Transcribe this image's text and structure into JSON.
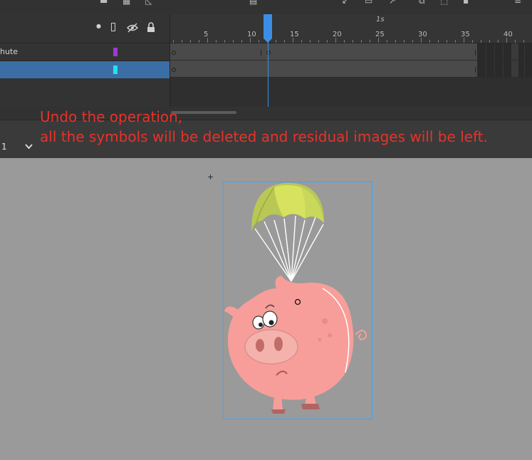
{
  "timeline": {
    "ruler_labels": [
      "5",
      "10",
      "15",
      "20",
      "25",
      "30",
      "35",
      "40"
    ],
    "time_marker": "1s",
    "current_frame": 12
  },
  "layers": [
    {
      "name": "hute",
      "color": "#9b3bd1",
      "selected": false
    },
    {
      "name": "",
      "color": "#26e0f0",
      "selected": true
    }
  ],
  "scene": {
    "zoom_value": "1"
  },
  "annotation": {
    "line1": "Undo the operation,",
    "line2": "all the symbols will be deleted and residual images will be left."
  },
  "colors": {
    "annotation_text": "#e8322a",
    "selection": "#3aa7ff",
    "stage": "#9a9a9a",
    "selected_layer": "#3b6ea5"
  }
}
